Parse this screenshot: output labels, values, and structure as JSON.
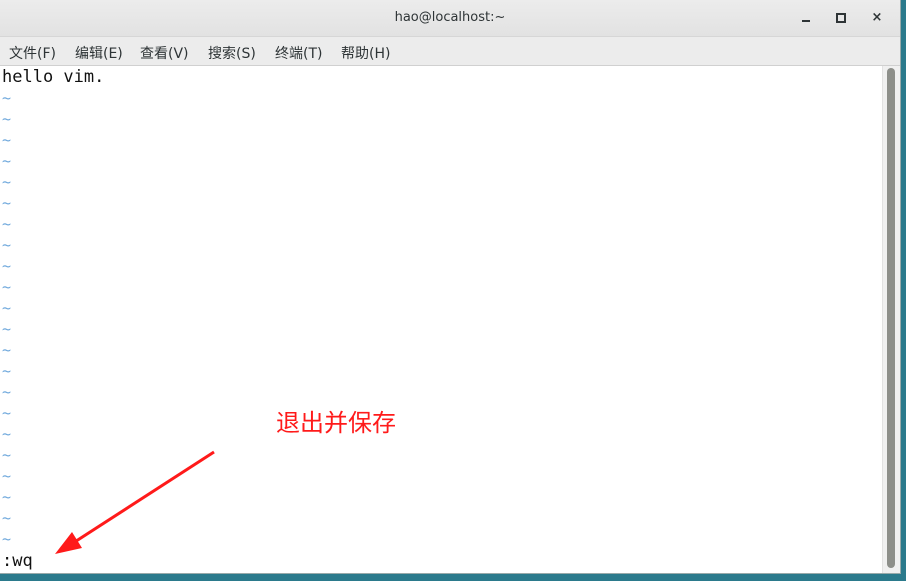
{
  "window": {
    "title": "hao@localhost:~",
    "buttons": {
      "minimize": "minimize",
      "maximize": "maximize",
      "close": "×"
    }
  },
  "menu": {
    "items": [
      "文件(F)",
      "编辑(E)",
      "查看(V)",
      "搜索(S)",
      "终端(T)",
      "帮助(H)"
    ]
  },
  "editor": {
    "first_line": "hello vim.",
    "tilde": "~",
    "command_line": ":wq"
  },
  "annotation": {
    "text": "退出并保存",
    "color": "#ff1a1a"
  },
  "colors": {
    "tilde": "#6fa8dc",
    "desktop": "#2b7a8c"
  }
}
